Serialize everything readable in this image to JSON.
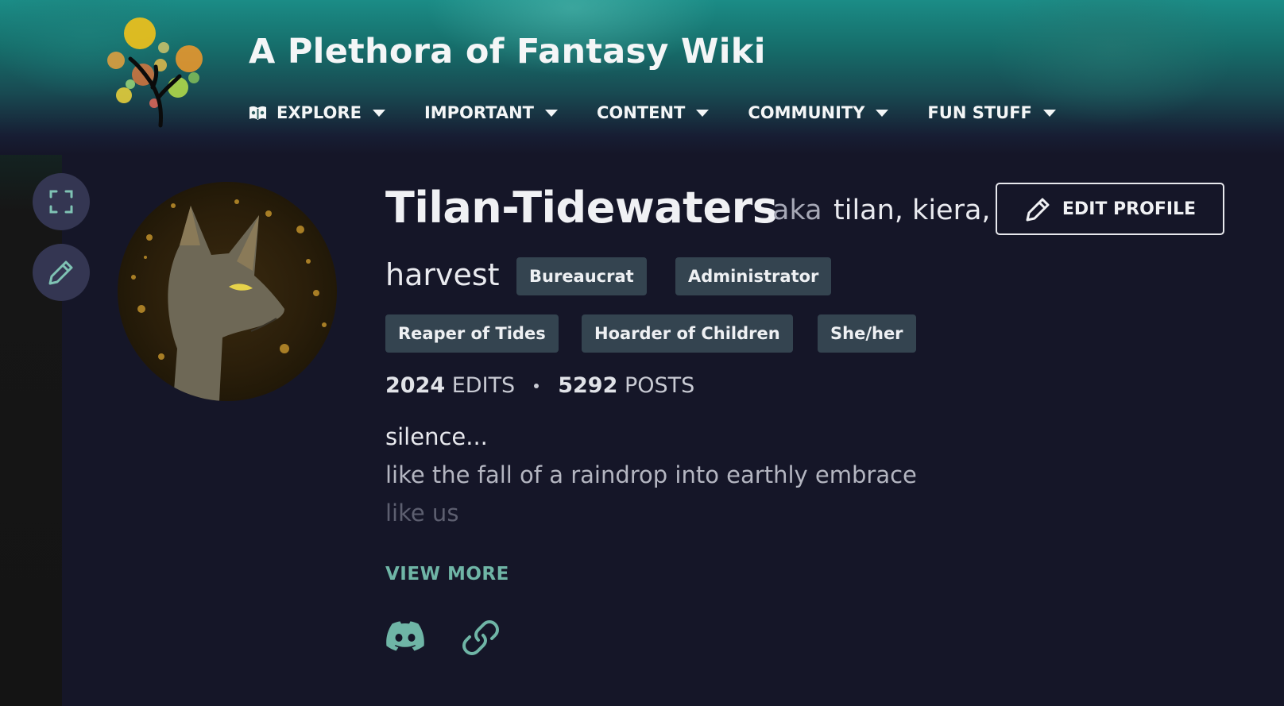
{
  "header": {
    "wiki_title": "A Plethora of Fantasy Wiki",
    "nav": [
      {
        "label": "EXPLORE"
      },
      {
        "label": "IMPORTANT"
      },
      {
        "label": "CONTENT"
      },
      {
        "label": "COMMUNITY"
      },
      {
        "label": "FUN STUFF"
      }
    ]
  },
  "profile": {
    "username": "Tilan-Tidewaters",
    "aka_label": "aka",
    "aka_names_line1": "tilan, kiera,",
    "aka_names_line2": "harvest",
    "edit_profile_label": "EDIT PROFILE",
    "tags": [
      "Bureaucrat",
      "Administrator",
      "Reaper of Tides",
      "Hoarder of Children",
      "She/her"
    ],
    "edits_count": "2024",
    "edits_label": "EDITS",
    "posts_count": "5292",
    "posts_label": "POSTS",
    "bio": [
      "silence...",
      "like the fall of a raindrop into earthly embrace",
      "like us"
    ],
    "view_more_label": "VIEW MORE"
  },
  "colors": {
    "background": "#151628",
    "accent": "#6fb5a6",
    "tag_bg": "#344450",
    "side_button_bg": "#343652"
  },
  "icons": {
    "side_buttons": [
      "expand-icon",
      "pencil-icon"
    ],
    "social": [
      "discord-icon",
      "link-icon"
    ]
  }
}
